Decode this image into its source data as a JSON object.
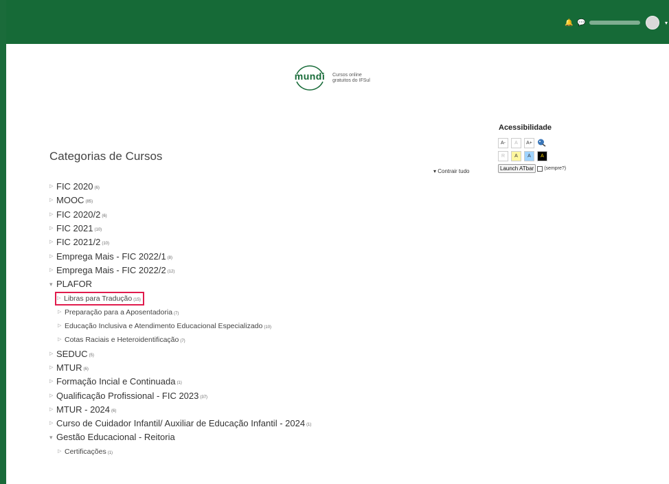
{
  "header": {
    "bell_icon": "bell-icon",
    "chat_icon": "chat-icon",
    "user_menu_caret": "▾"
  },
  "logo": {
    "word": "mundi",
    "tagline_line1": "Cursos online",
    "tagline_line2": "gratuitos do IFSul"
  },
  "page": {
    "title": "Categorias de Cursos",
    "collapse_label": "Contrair tudo"
  },
  "categories": [
    {
      "label": "FIC 2020",
      "count": "(6)",
      "expanded": false
    },
    {
      "label": "MOOC",
      "count": "(85)",
      "expanded": false
    },
    {
      "label": "FIC 2020/2",
      "count": "(6)",
      "expanded": false
    },
    {
      "label": "FIC 2021",
      "count": "(10)",
      "expanded": false
    },
    {
      "label": "FIC 2021/2",
      "count": "(10)",
      "expanded": false
    },
    {
      "label": "Emprega Mais - FIC 2022/1",
      "count": "(8)",
      "expanded": false
    },
    {
      "label": "Emprega Mais - FIC 2022/2",
      "count": "(12)",
      "expanded": false
    },
    {
      "label": "PLAFOR",
      "count": "",
      "expanded": true
    },
    {
      "label": "Libras para Tradução",
      "count": "(15)",
      "sub": true,
      "highlighted": true
    },
    {
      "label": "Preparação para a Aposentadoria",
      "count": "(7)",
      "sub": true
    },
    {
      "label": "Educação Inclusiva e Atendimento Educacional Especializado",
      "count": "(10)",
      "sub": true
    },
    {
      "label": "Cotas Raciais e Heteroidentificação",
      "count": "(7)",
      "sub": true
    },
    {
      "label": "SEDUC",
      "count": "(5)",
      "expanded": false
    },
    {
      "label": "MTUR",
      "count": "(6)",
      "expanded": false
    },
    {
      "label": "Formação Incial e Continuada",
      "count": "(1)",
      "expanded": false
    },
    {
      "label": "Qualificação Profissional - FIC 2023",
      "count": "(37)",
      "expanded": false
    },
    {
      "label": "MTUR - 2024",
      "count": "(6)",
      "expanded": false
    },
    {
      "label": "Curso de Cuidador Infantil/ Auxiliar de Educação Infantil - 2024",
      "count": "(1)",
      "expanded": false
    },
    {
      "label": "Gestão Educacional - Reitoria",
      "count": "",
      "expanded": true
    },
    {
      "label": "Certificações",
      "count": "(1)",
      "sub": true
    }
  ],
  "accessibility": {
    "title": "Acessibilidade",
    "font_buttons": [
      "A-",
      "A",
      "A+"
    ],
    "contrast_buttons": [
      "R",
      "A",
      "A",
      "A"
    ],
    "launch_label": "Launch ATbar",
    "always_label": "(sempre?)"
  }
}
